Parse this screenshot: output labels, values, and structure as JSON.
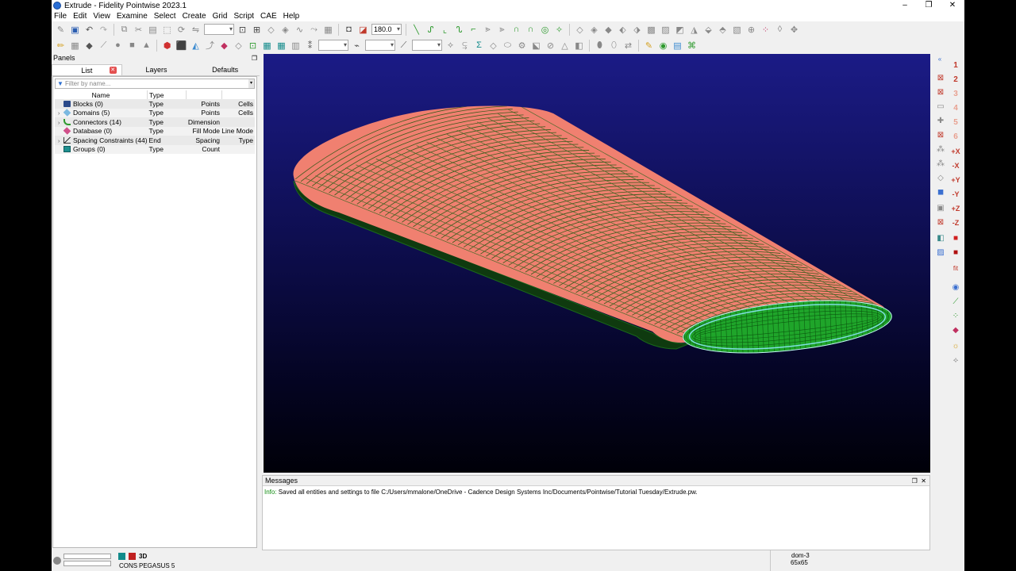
{
  "window": {
    "title": "Extrude - Fidelity Pointwise 2023.1",
    "minimize": "–",
    "restore": "❐",
    "close": "✕"
  },
  "menu": [
    "File",
    "Edit",
    "View",
    "Examine",
    "Select",
    "Create",
    "Grid",
    "Script",
    "CAE",
    "Help"
  ],
  "toolbar": {
    "angle_value": "180.0"
  },
  "panels": {
    "header": "Panels",
    "tabs": [
      "List",
      "Layers",
      "Defaults"
    ],
    "filter_placeholder": "Filter by name...",
    "columns": [
      "Name",
      "Type"
    ],
    "rows": [
      {
        "name": "Blocks (0)",
        "c2": "Type",
        "c3": "Points",
        "c4": "Cells",
        "expand": ""
      },
      {
        "name": "Domains (5)",
        "c2": "Type",
        "c3": "Points",
        "c4": "Cells",
        "expand": "›"
      },
      {
        "name": "Connectors (14)",
        "c2": "Type",
        "c3": "Dimension",
        "c4": "",
        "expand": "›"
      },
      {
        "name": "Database (0)",
        "c2": "Type",
        "c3": "Fill Mode",
        "c4": "Line Mode",
        "expand": ""
      },
      {
        "name": "Spacing Constraints (44)",
        "c2": "End",
        "c3": "Spacing",
        "c4": "Type",
        "expand": "›"
      },
      {
        "name": "Groups (0)",
        "c2": "Type",
        "c3": "Count",
        "c4": "",
        "expand": ""
      }
    ]
  },
  "messages": {
    "header": "Messages",
    "prefix": "Info:",
    "text": " Saved all entities and settings to file C:/Users/mmalone/OneDrive - Cadence Design Systems Inc/Documents/Pointwise/Tutorial Tuesday/Extrude.pw."
  },
  "statusbar": {
    "mode_3d": "3D",
    "cons": "CONS",
    "solver": "PEGASUS 5",
    "selection_name": "dom-3",
    "selection_dims": "65x65"
  },
  "right_toolbar": {
    "labels": [
      "1",
      "2",
      "3",
      "4",
      "5",
      "6",
      "+X",
      "-X",
      "+Y",
      "-Y",
      "+Z",
      "-Z",
      "fit"
    ]
  },
  "colors": {
    "viewport_top": "#1b1b86",
    "viewport_bottom": "#000008",
    "surface_mesh_salmon": "#f08070",
    "end_cap_green": "#1fa52a",
    "accent_green": "#0d8a0d"
  }
}
